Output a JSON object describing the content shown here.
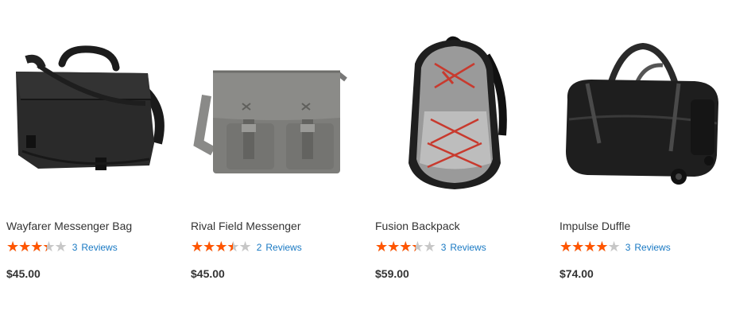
{
  "products": [
    {
      "name": "Wayfarer Messenger Bag",
      "rating_percent": 67,
      "review_count": "3",
      "reviews_label": "Reviews",
      "price": "$45.00",
      "image_icon": "messenger-bag-black"
    },
    {
      "name": "Rival Field Messenger",
      "rating_percent": 70,
      "review_count": "2",
      "reviews_label": "Reviews",
      "price": "$45.00",
      "image_icon": "messenger-bag-gray"
    },
    {
      "name": "Fusion Backpack",
      "rating_percent": 67,
      "review_count": "3",
      "reviews_label": "Reviews",
      "price": "$59.00",
      "image_icon": "backpack-gray"
    },
    {
      "name": "Impulse Duffle",
      "rating_percent": 80,
      "review_count": "3",
      "reviews_label": "Reviews",
      "price": "$74.00",
      "image_icon": "duffle-bag-black"
    }
  ],
  "colors": {
    "star_filled": "#ff5501",
    "star_empty": "#c7c7c7",
    "link": "#1979c3",
    "text": "#333333"
  }
}
